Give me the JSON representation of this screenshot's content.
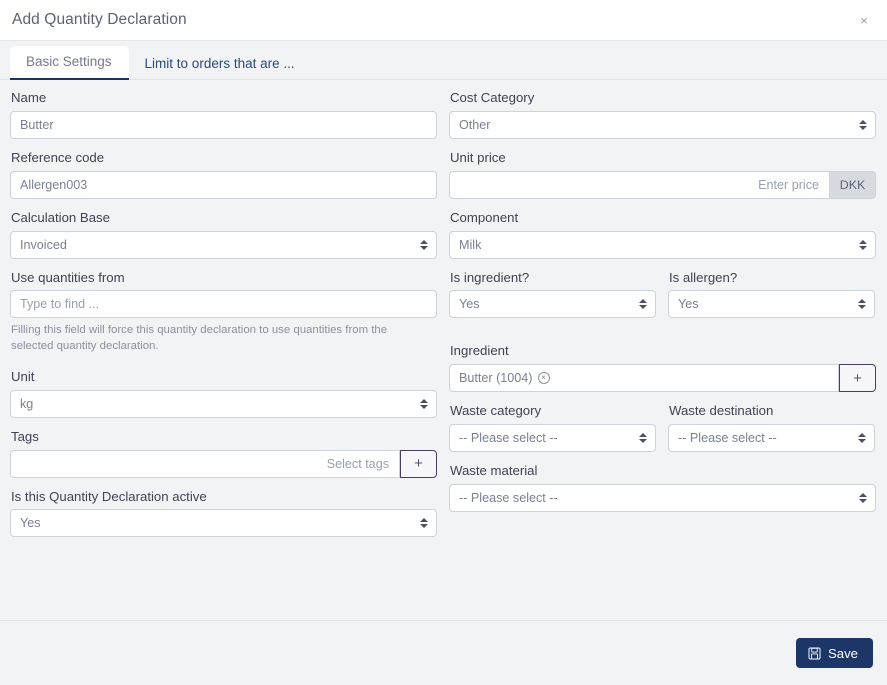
{
  "header": {
    "title": "Add Quantity Declaration",
    "close_label": "×"
  },
  "tabs": [
    {
      "label": "Basic Settings",
      "active": true
    },
    {
      "label": "Limit to orders that are ...",
      "active": false
    }
  ],
  "form": {
    "name": {
      "label": "Name",
      "value": "Butter"
    },
    "cost_category": {
      "label": "Cost Category",
      "value": "Other"
    },
    "reference_code": {
      "label": "Reference code",
      "value": "Allergen003"
    },
    "unit_price": {
      "label": "Unit price",
      "value": "",
      "placeholder": "Enter price",
      "currency": "DKK"
    },
    "calculation_base": {
      "label": "Calculation Base",
      "value": "Invoiced"
    },
    "component": {
      "label": "Component",
      "value": "Milk"
    },
    "use_quantities_from": {
      "label": "Use quantities from",
      "value": "",
      "placeholder": "Type to find ...",
      "help": "Filling this field will force this quantity declaration to use quantities from the selected quantity declaration."
    },
    "is_ingredient": {
      "label": "Is ingredient?",
      "value": "Yes"
    },
    "is_allergen": {
      "label": "Is allergen?",
      "value": "Yes"
    },
    "ingredient": {
      "label": "Ingredient",
      "tag": "Butter (1004)",
      "remove_label": "×",
      "add_label": "+"
    },
    "unit": {
      "label": "Unit",
      "value": "kg"
    },
    "waste_category": {
      "label": "Waste category",
      "value": "-- Please select --"
    },
    "waste_destination": {
      "label": "Waste destination",
      "value": "-- Please select --"
    },
    "waste_material": {
      "label": "Waste material",
      "value": "-- Please select --"
    },
    "tags": {
      "label": "Tags",
      "value": "",
      "placeholder": "Select tags",
      "add_label": "+"
    },
    "active": {
      "label": "Is this Quantity Declaration active",
      "value": "Yes"
    }
  },
  "footer": {
    "save_label": "Save"
  },
  "colors": {
    "accent_navy": "#1c3667",
    "tab_link": "#2c4a7c",
    "addon_grey": "#d7dade",
    "plus_border": "#4b3f5e"
  }
}
